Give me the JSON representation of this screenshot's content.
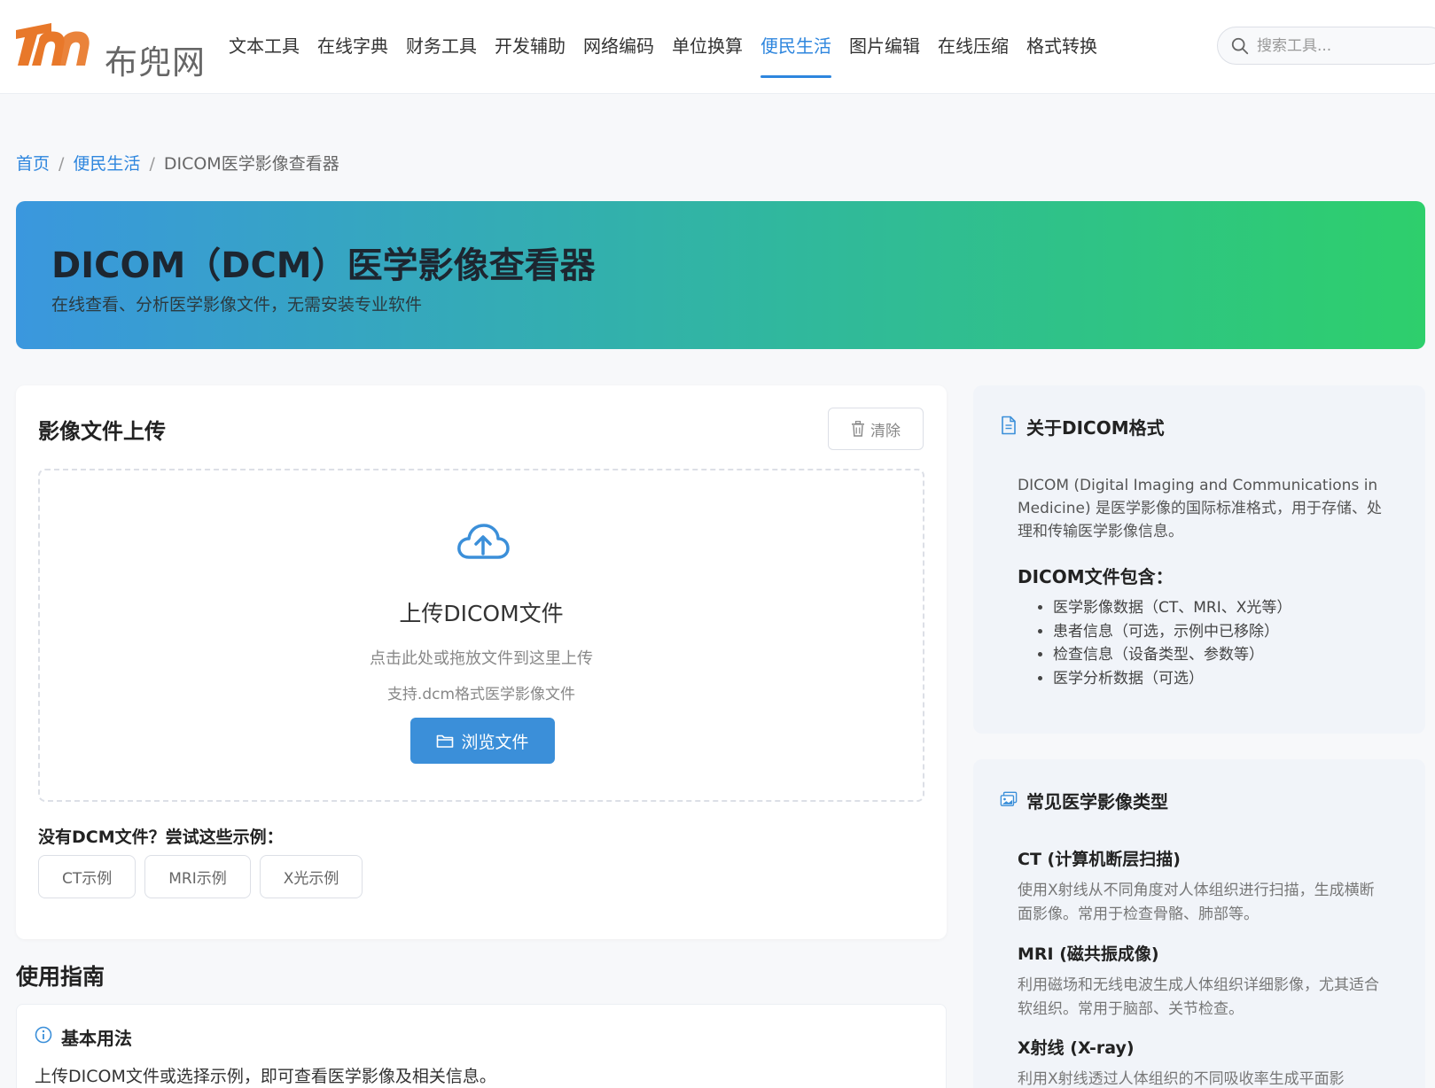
{
  "site": {
    "logo_text": "布兜网",
    "brand_color": "#e8782a"
  },
  "nav": {
    "items": [
      {
        "label": "文本工具",
        "active": false
      },
      {
        "label": "在线字典",
        "active": false
      },
      {
        "label": "财务工具",
        "active": false
      },
      {
        "label": "开发辅助",
        "active": false
      },
      {
        "label": "网络编码",
        "active": false
      },
      {
        "label": "单位换算",
        "active": false
      },
      {
        "label": "便民生活",
        "active": true
      },
      {
        "label": "图片编辑",
        "active": false
      },
      {
        "label": "在线压缩",
        "active": false
      },
      {
        "label": "格式转换",
        "active": false
      }
    ],
    "active_color": "#2e86de"
  },
  "search": {
    "placeholder": "搜索工具..."
  },
  "breadcrumb": {
    "home": "首页",
    "category": "便民生活",
    "current": "DICOM医学影像查看器",
    "separator": "/"
  },
  "banner": {
    "title": "DICOM（DCM）医学影像查看器",
    "subtitle": "在线查看、分析医学影像文件，无需安装专业软件"
  },
  "upload": {
    "title": "影像文件上传",
    "clear_label": "清除",
    "drop_title": "上传DICOM文件",
    "drop_hint": "点击此处或拖放文件到这里上传",
    "drop_support": "支持.dcm格式医学影像文件",
    "browse_label": "浏览文件",
    "examples_label": "没有DCM文件？尝试这些示例：",
    "examples": [
      "CT示例",
      "MRI示例",
      "X光示例"
    ]
  },
  "guide": {
    "title": "使用指南",
    "basic_title": "基本用法",
    "basic_text": "上传DICOM文件或选择示例，即可查看医学影像及相关信息。"
  },
  "about": {
    "title": "关于DICOM格式",
    "text": "DICOM (Digital Imaging and Communications in Medicine) 是医学影像的国际标准格式，用于存储、处理和传输医学影像信息。",
    "contains_title": "DICOM文件包含：",
    "contains": [
      "医学影像数据（CT、MRI、X光等）",
      "患者信息（可选，示例中已移除）",
      "检查信息（设备类型、参数等）",
      "医学分析数据（可选）"
    ]
  },
  "types": {
    "title": "常见医学影像类型",
    "items": [
      {
        "name": "CT (计算机断层扫描)",
        "desc": "使用X射线从不同角度对人体组织进行扫描，生成横断面影像。常用于检查骨骼、肺部等。"
      },
      {
        "name": "MRI (磁共振成像)",
        "desc": "利用磁场和无线电波生成人体组织详细影像，尤其适合软组织。常用于脑部、关节检查。"
      },
      {
        "name": "X射线 (X-ray)",
        "desc": "利用X射线透过人体组织的不同吸收率生成平面影"
      }
    ]
  }
}
